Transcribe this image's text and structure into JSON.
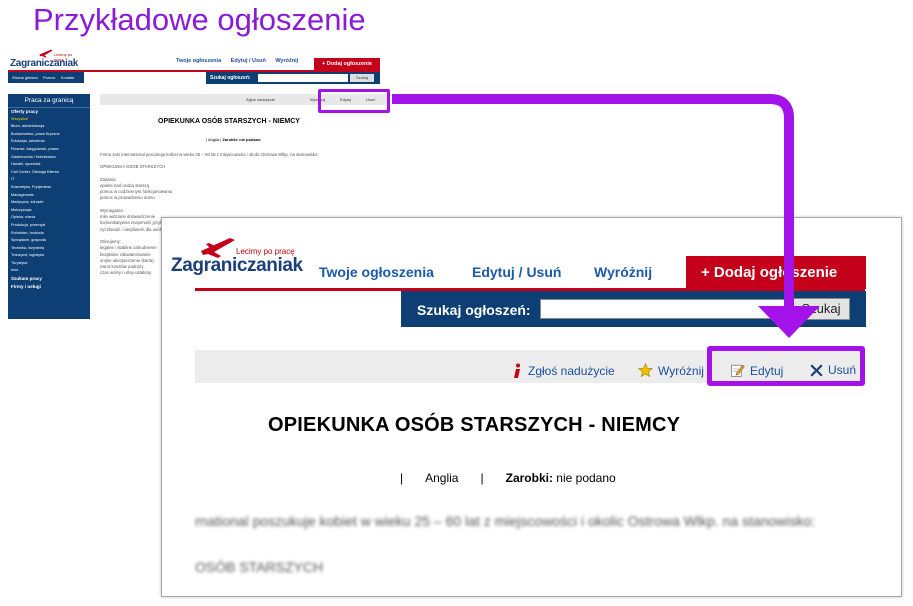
{
  "heading": "Przykładowe ogłoszenie",
  "brand": {
    "name": "Zagraniczaniak",
    "tagline": "Lecimy po pracę"
  },
  "nav": {
    "my_ads": "Twoje ogłoszenia",
    "edit_delete": "Edytuj / Usuń",
    "highlight": "Wyróżnij",
    "add_ad": "+ Dodaj ogłoszenie"
  },
  "search": {
    "label": "Szukaj ogłoszeń:",
    "value": "",
    "button": "Szukaj"
  },
  "small_nav": {
    "items": [
      "Strona główna",
      "Pomoc",
      "Kontakt"
    ]
  },
  "sidebar": {
    "title": "Praca za granicą",
    "sections": [
      "Oferty pracy",
      "Szukam pracy",
      "Firmy i usługi"
    ],
    "items": [
      "Wszystkie",
      "Biuro, administracja",
      "Budownictwo, prace fizyczne",
      "Edukacja, szkolenia",
      "Finanse, księgowość, prawo",
      "Gastronomia i Hotelarstwo",
      "Handel, sprzedaż",
      "Call Center, Obsługa Klienta",
      "IT",
      "Kosmetyka, Fryzjerstwo",
      "Managerowie",
      "Medycyna, zdrowie",
      "Motoryzacja",
      "Opieka, niania",
      "Produkcja, przemysł",
      "Rolnictwo, hodowla",
      "Sprzątanie, gospoda",
      "Technika, inżynieria",
      "Transport, logistyka",
      "Turystyka",
      "Inne"
    ]
  },
  "toolbar": {
    "report": "Zgłoś nadużycie",
    "highlight": "Wyróżnij",
    "edit": "Edytuj",
    "delete": "Usuń"
  },
  "listing": {
    "title": "OPIEKUNKA OSÓB STARSZYCH - NIEMCY",
    "sep": "|",
    "country": "Anglia",
    "salary_label": "Zarobki:",
    "salary_value": "nie podano",
    "body_line1": "rnational poszukuje kobiet w wieku 25 – 60 lat z miejscowości i okolic Ostrowa Wlkp. na stanowisko:",
    "body_line2": "OSÓB STARSZYCH",
    "small_body": [
      "Firma Jani international poszukuje kobiet w wieku 25 – 60 lat z miejscowości i okolic Ostrowa Wlkp. na stanowisko:",
      "OPIEKUNKA OSÓB STARSZYCH",
      "Zadania:",
      "opieka nad osobą starszą",
      "pomoc w codziennym funkcjonowaniu",
      "pomoc w prowadzeniu domu",
      "Wymagania:",
      "mile widziane doświadczenie",
      "komunikatywna znajomość języka",
      "życzliwość i cierpliwość dla osób",
      "Oferujemy:",
      "legalne i stabilne zatrudnienie",
      "bezpłatne zakwaterowanie",
      "unijne ubezpieczenie (karta)",
      "zwrot kosztów podróży",
      "czas wolny i urlop ustalony"
    ]
  },
  "colors": {
    "accent_purple": "#a312e8",
    "brand_red": "#c4001a",
    "brand_navy": "#0d3f74",
    "link_blue": "#1a5aa8"
  }
}
